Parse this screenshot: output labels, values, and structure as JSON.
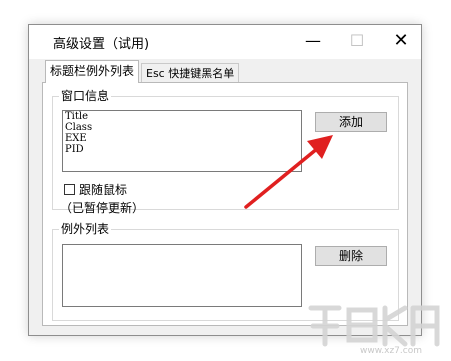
{
  "window": {
    "title": "高级设置（试用)"
  },
  "controls": {
    "minimize": "—",
    "maximize": "☐",
    "close": "✕"
  },
  "tabs": [
    {
      "label": "标题栏例外列表"
    },
    {
      "label": "Esc 快捷键黑名单"
    }
  ],
  "window_info": {
    "group_label": "窗口信息",
    "lines": [
      "Title",
      "Class",
      "EXE",
      "PID"
    ],
    "add_button": "添加",
    "follow_mouse_label": "跟随鼠标",
    "status_text": "（已暂停更新）"
  },
  "exceptions": {
    "group_label": "例外列表",
    "delete_button": "删除"
  },
  "watermark": {
    "url": "www.xz7.com"
  },
  "colors": {
    "arrow": "#e02020",
    "accent": "#e02020"
  },
  "icons": {
    "arrow": "red-arrow-annotation",
    "watermark": "xiazaiba-logo"
  }
}
